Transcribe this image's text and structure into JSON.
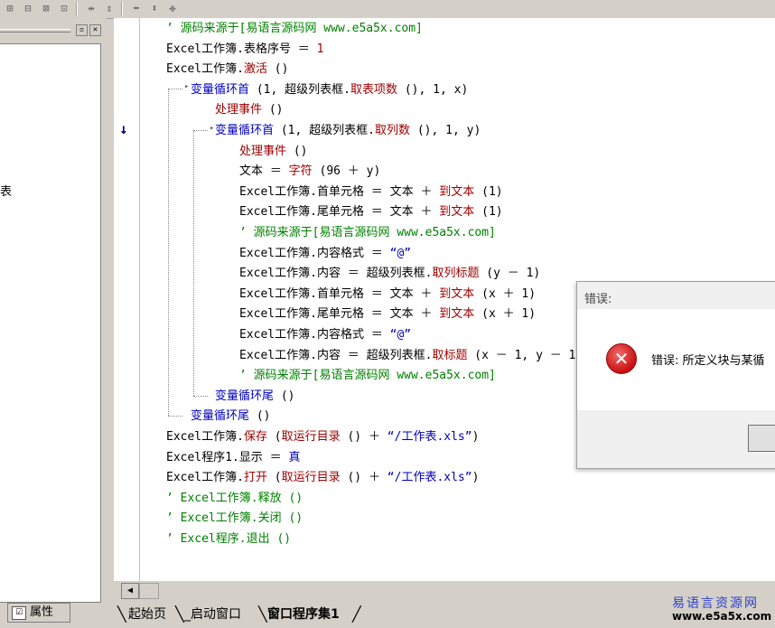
{
  "toolbar": {
    "icons": [
      "align-left-icon",
      "align-center-icon",
      "align-right-icon",
      "align-top-icon",
      "equal-width-icon",
      "equal-height-icon",
      "center-horizontal-icon",
      "center-vertical-icon",
      "center-both-icon"
    ]
  },
  "left_panel": {
    "partial_text": "表",
    "properties_tab_label": "属性"
  },
  "editor": {
    "lines": [
      [
        {
          "t": "’ 源码来源于[易语言源码网 www.e5a5x.com]",
          "c": "cmt"
        }
      ],
      [
        {
          "t": "Excel工作簿.表格序号 ＝ ",
          "c": ""
        },
        {
          "t": "1",
          "c": "fn"
        }
      ],
      [
        {
          "t": "Excel工作簿.",
          "c": ""
        },
        {
          "t": "激活",
          "c": "fn"
        },
        {
          "t": " ()",
          "c": ""
        }
      ],
      [
        {
          "t": "变量循环首",
          "c": "kw"
        },
        {
          "t": " (1, 超级列表框.",
          "c": ""
        },
        {
          "t": "取表项数",
          "c": "fn"
        },
        {
          "t": " (), 1, x)",
          "c": ""
        }
      ],
      [
        {
          "t": "处理事件",
          "c": "fn"
        },
        {
          "t": " ()",
          "c": ""
        }
      ],
      [
        {
          "t": "变量循环首",
          "c": "kw"
        },
        {
          "t": " (1, 超级列表框.",
          "c": ""
        },
        {
          "t": "取列数",
          "c": "fn"
        },
        {
          "t": " (), 1, y)",
          "c": ""
        }
      ],
      [
        {
          "t": "处理事件",
          "c": "fn"
        },
        {
          "t": " ()",
          "c": ""
        }
      ],
      [
        {
          "t": "文本 ＝ ",
          "c": ""
        },
        {
          "t": "字符",
          "c": "fn"
        },
        {
          "t": " (96 ＋ y)",
          "c": ""
        }
      ],
      [
        {
          "t": "Excel工作簿.首单元格 ＝ 文本 ＋ ",
          "c": ""
        },
        {
          "t": "到文本",
          "c": "fn"
        },
        {
          "t": " (1)",
          "c": ""
        }
      ],
      [
        {
          "t": "Excel工作簿.尾单元格 ＝ 文本 ＋ ",
          "c": ""
        },
        {
          "t": "到文本",
          "c": "fn"
        },
        {
          "t": " (1)",
          "c": ""
        }
      ],
      [
        {
          "t": "’ 源码来源于[易语言源码网 www.e5a5x.com]",
          "c": "cmt"
        }
      ],
      [
        {
          "t": "Excel工作簿.内容格式 ＝ ",
          "c": ""
        },
        {
          "t": "“@”",
          "c": "str"
        }
      ],
      [
        {
          "t": "Excel工作簿.内容 ＝ 超级列表框.",
          "c": ""
        },
        {
          "t": "取列标题",
          "c": "fn"
        },
        {
          "t": " (y － 1)",
          "c": ""
        }
      ],
      [
        {
          "t": "Excel工作簿.首单元格 ＝ 文本 ＋ ",
          "c": ""
        },
        {
          "t": "到文本",
          "c": "fn"
        },
        {
          "t": " (x ＋ 1)",
          "c": ""
        }
      ],
      [
        {
          "t": "Excel工作簿.尾单元格 ＝ 文本 ＋ ",
          "c": ""
        },
        {
          "t": "到文本",
          "c": "fn"
        },
        {
          "t": " (x ＋ 1)",
          "c": ""
        }
      ],
      [
        {
          "t": "Excel工作簿.内容格式 ＝ ",
          "c": ""
        },
        {
          "t": "“@”",
          "c": "str"
        }
      ],
      [
        {
          "t": "Excel工作簿.内容 ＝ 超级列表框.",
          "c": ""
        },
        {
          "t": "取标题",
          "c": "fn"
        },
        {
          "t": " (x － 1, y － 1)",
          "c": ""
        }
      ],
      [
        {
          "t": "’ 源码来源于[易语言源码网 www.e5a5x.com]",
          "c": "cmt"
        }
      ],
      [
        {
          "t": "变量循环尾",
          "c": "kw"
        },
        {
          "t": " ()",
          "c": ""
        }
      ],
      [
        {
          "t": "变量循环尾",
          "c": "kw"
        },
        {
          "t": " ()",
          "c": ""
        }
      ],
      [
        {
          "t": "Excel工作簿.",
          "c": ""
        },
        {
          "t": "保存",
          "c": "fn"
        },
        {
          "t": " (",
          "c": ""
        },
        {
          "t": "取运行目录",
          "c": "fn"
        },
        {
          "t": " () ＋ ",
          "c": ""
        },
        {
          "t": "“/工作表.xls”",
          "c": "str"
        },
        {
          "t": ")",
          "c": ""
        }
      ],
      [
        {
          "t": "Excel程序1.显示 ＝ ",
          "c": ""
        },
        {
          "t": "真",
          "c": "kw"
        }
      ],
      [
        {
          "t": "Excel工作簿.",
          "c": ""
        },
        {
          "t": "打开",
          "c": "fn"
        },
        {
          "t": " (",
          "c": ""
        },
        {
          "t": "取运行目录",
          "c": "fn"
        },
        {
          "t": " () ＋ ",
          "c": ""
        },
        {
          "t": "“/工作表.xls”",
          "c": "str"
        },
        {
          "t": ")",
          "c": ""
        }
      ],
      [
        {
          "t": "’ Excel工作簿.释放 ()",
          "c": "cmt"
        }
      ],
      [
        {
          "t": "’ Excel工作簿.关闭 ()",
          "c": "cmt"
        }
      ],
      [
        {
          "t": "’ Excel程序.退出 ()",
          "c": "cmt"
        }
      ]
    ],
    "indent_levels": [
      0,
      0,
      0,
      1,
      2,
      2,
      3,
      3,
      3,
      3,
      3,
      3,
      3,
      3,
      3,
      3,
      3,
      3,
      2,
      1,
      0,
      0,
      0,
      0,
      0,
      0
    ],
    "current_line_marker": "↓"
  },
  "tabs": [
    {
      "label": "起始页",
      "active": false
    },
    {
      "label": "_启动窗口",
      "active": false
    },
    {
      "label": "窗口程序集1",
      "active": true
    }
  ],
  "watermark": {
    "top": "易语言资源网",
    "bottom": "www.e5a5x.com"
  },
  "dialog": {
    "title": "错误:",
    "message": "错误: 所定义块与某循",
    "icon": "error-icon"
  }
}
